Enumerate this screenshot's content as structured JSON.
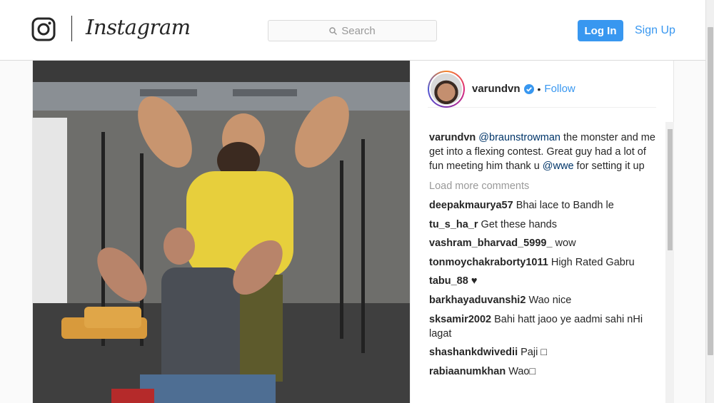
{
  "header": {
    "logo_text": "Instagram",
    "search_placeholder": "Search",
    "login_label": "Log In",
    "signup_label": "Sign Up"
  },
  "post": {
    "author": "varundvn",
    "follow_label": "Follow",
    "caption": {
      "user": "varundvn",
      "mention_1": "@braunstrowman",
      "text_1": " the monster and me get into a flexing contest. Great guy had a lot of fun meeting him thank u ",
      "mention_2": "@wwe",
      "text_2": " for setting it up"
    },
    "load_more_label": "Load more comments",
    "comments": [
      {
        "user": "deepakmaurya57",
        "text": "Bhai lace to Bandh le"
      },
      {
        "user": "tu_s_ha_r",
        "text": "Get these hands"
      },
      {
        "user": "vashram_bharvad_5999_",
        "text": "wow"
      },
      {
        "user": "tonmoychakraborty1011",
        "text": "High Rated Gabru"
      },
      {
        "user": "tabu_88",
        "text": "♥"
      },
      {
        "user": "barkhayaduvanshi2",
        "text": "Wao nice"
      },
      {
        "user": "sksamir2002",
        "text": "Bahi hatt jaoo ye aadmi sahi nHi lagat"
      },
      {
        "user": "shashankdwivedii",
        "text": "Paji □"
      },
      {
        "user": "rabiaanumkhan",
        "text": "Wao□"
      }
    ]
  },
  "colors": {
    "accent": "#3897f0",
    "mention": "#003569",
    "muted": "#999999"
  },
  "icons": {
    "logo": "instagram-glyph-icon",
    "search": "search-icon",
    "verified": "verified-badge-icon"
  }
}
